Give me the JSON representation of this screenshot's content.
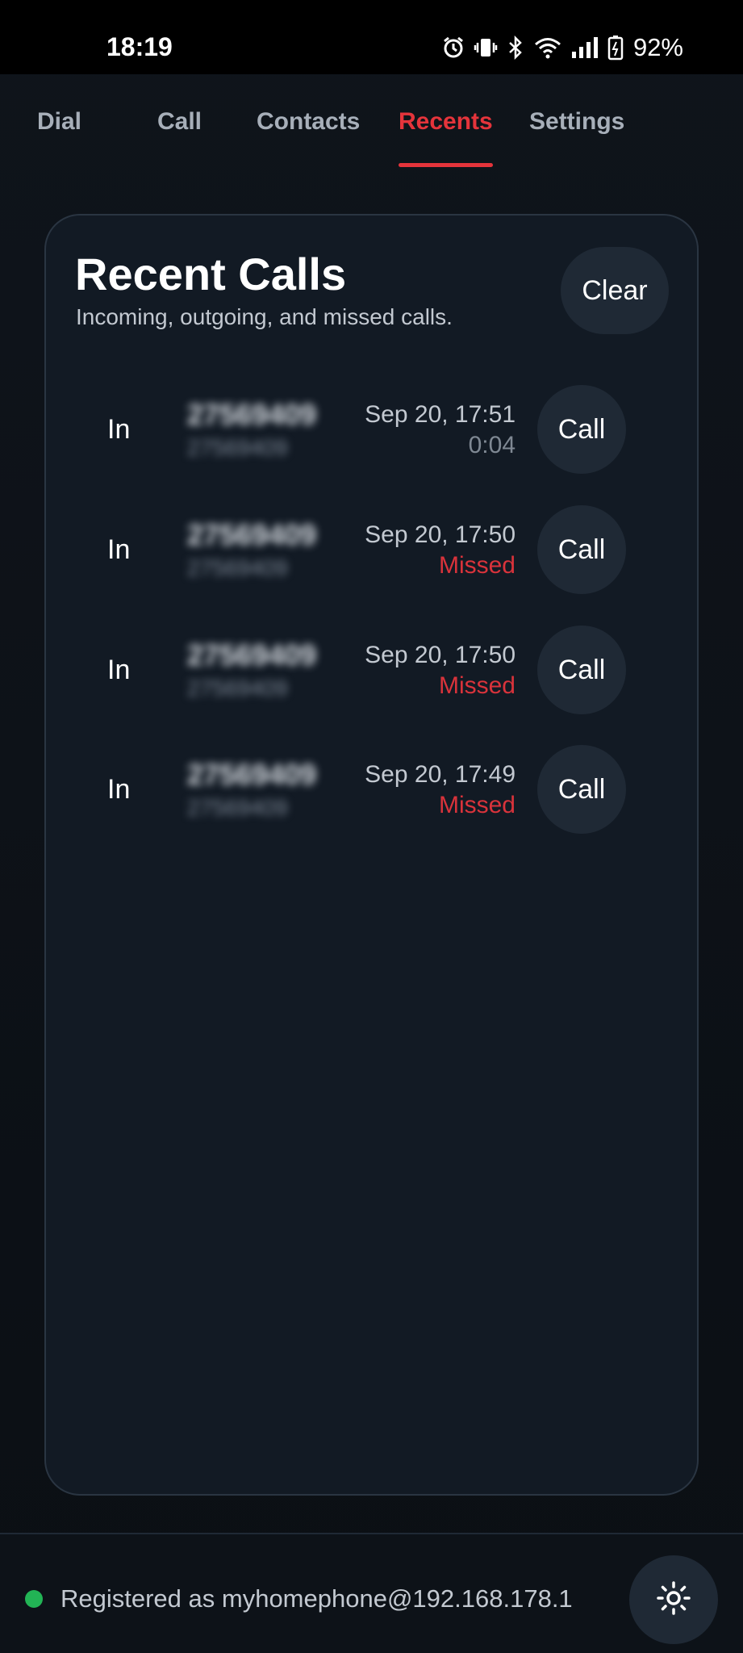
{
  "status_bar": {
    "time": "18:19",
    "battery": "92%",
    "icons": [
      "alarm-icon",
      "vibrate-icon",
      "bluetooth-icon",
      "wifi-icon",
      "signal-icon",
      "battery-icon"
    ]
  },
  "tabs": [
    {
      "label": "Dial",
      "active": false
    },
    {
      "label": "Call",
      "active": false
    },
    {
      "label": "Contacts",
      "active": false
    },
    {
      "label": "Recents",
      "active": true
    },
    {
      "label": "Settings",
      "active": false
    }
  ],
  "recents": {
    "title": "Recent Calls",
    "subtitle": "Incoming, outgoing, and missed calls.",
    "clear_label": "Clear",
    "calls": [
      {
        "direction": "In",
        "name": "27569409",
        "number": "27569409",
        "time": "Sep 20, 17:51",
        "status": "0:04",
        "status_type": "duration",
        "call_label": "Call"
      },
      {
        "direction": "In",
        "name": "27569409",
        "number": "27569409",
        "time": "Sep 20, 17:50",
        "status": "Missed",
        "status_type": "missed",
        "call_label": "Call"
      },
      {
        "direction": "In",
        "name": "27569409",
        "number": "27569409",
        "time": "Sep 20, 17:50",
        "status": "Missed",
        "status_type": "missed",
        "call_label": "Call"
      },
      {
        "direction": "In",
        "name": "27569409",
        "number": "27569409",
        "time": "Sep 20, 17:49",
        "status": "Missed",
        "status_type": "missed",
        "call_label": "Call"
      }
    ]
  },
  "footer": {
    "registration_text": "Registered as myhomephone@192.168.178.1",
    "registration_status_color": "#22b455",
    "theme_icon": "sun-icon"
  },
  "colors": {
    "accent": "#e5343b",
    "missed": "#d9333b",
    "background": "#0f141b",
    "card": "#121a24",
    "button": "#1f2935"
  }
}
